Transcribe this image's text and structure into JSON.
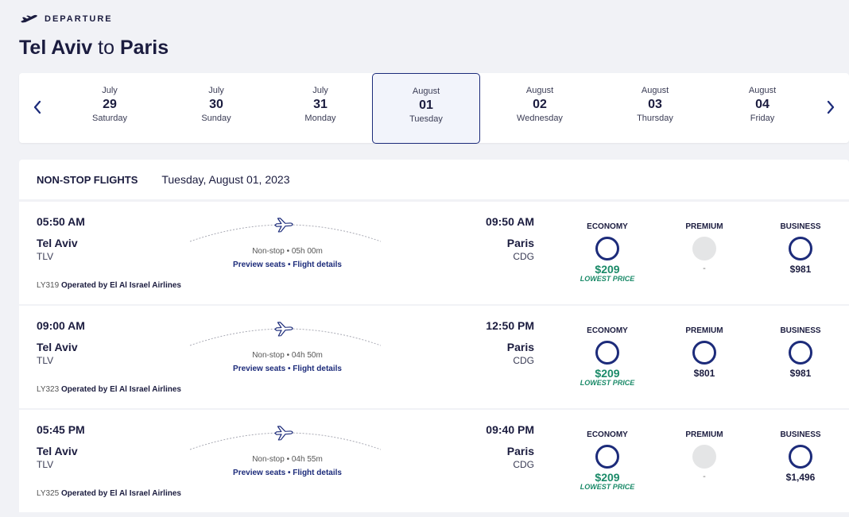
{
  "header": {
    "departure_label": "DEPARTURE",
    "origin": "Tel Aviv",
    "connector": "to",
    "destination": "Paris"
  },
  "dates": [
    {
      "month": "July",
      "day": "29",
      "weekday": "Saturday"
    },
    {
      "month": "July",
      "day": "30",
      "weekday": "Sunday"
    },
    {
      "month": "July",
      "day": "31",
      "weekday": "Monday"
    },
    {
      "month": "August",
      "day": "01",
      "weekday": "Tuesday"
    },
    {
      "month": "August",
      "day": "02",
      "weekday": "Wednesday"
    },
    {
      "month": "August",
      "day": "03",
      "weekday": "Thursday"
    },
    {
      "month": "August",
      "day": "04",
      "weekday": "Friday"
    }
  ],
  "results": {
    "section_title": "NON-STOP FLIGHTS",
    "date_title": "Tuesday, August 01, 2023"
  },
  "fare_labels": {
    "economy": "ECONOMY",
    "premium": "PREMIUM",
    "business": "BUSINESS"
  },
  "links": {
    "preview": "Preview seats",
    "details": "Flight details",
    "separator": "•"
  },
  "flights": [
    {
      "dep_time": "05:50 AM",
      "arr_time": "09:50 AM",
      "from_city": "Tel Aviv",
      "from_code": "TLV",
      "to_city": "Paris",
      "to_code": "CDG",
      "stops": "Non-stop",
      "duration": "05h 00m",
      "flight_no": "LY319",
      "operator": "Operated by El Al Israel Airlines",
      "economy_price": "$209",
      "economy_note": "LOWEST PRICE",
      "premium_price": "-",
      "business_price": "$981"
    },
    {
      "dep_time": "09:00 AM",
      "arr_time": "12:50 PM",
      "from_city": "Tel Aviv",
      "from_code": "TLV",
      "to_city": "Paris",
      "to_code": "CDG",
      "stops": "Non-stop",
      "duration": "04h 50m",
      "flight_no": "LY323",
      "operator": "Operated by El Al Israel Airlines",
      "economy_price": "$209",
      "economy_note": "LOWEST PRICE",
      "premium_price": "$801",
      "business_price": "$981"
    },
    {
      "dep_time": "05:45 PM",
      "arr_time": "09:40 PM",
      "from_city": "Tel Aviv",
      "from_code": "TLV",
      "to_city": "Paris",
      "to_code": "CDG",
      "stops": "Non-stop",
      "duration": "04h 55m",
      "flight_no": "LY325",
      "operator": "Operated by El Al Israel Airlines",
      "economy_price": "$209",
      "economy_note": "LOWEST PRICE",
      "premium_price": "-",
      "business_price": "$1,496"
    }
  ],
  "colors": {
    "navy": "#1c2b7a",
    "green": "#1a8a68",
    "unavailable": "#e4e5e6"
  }
}
